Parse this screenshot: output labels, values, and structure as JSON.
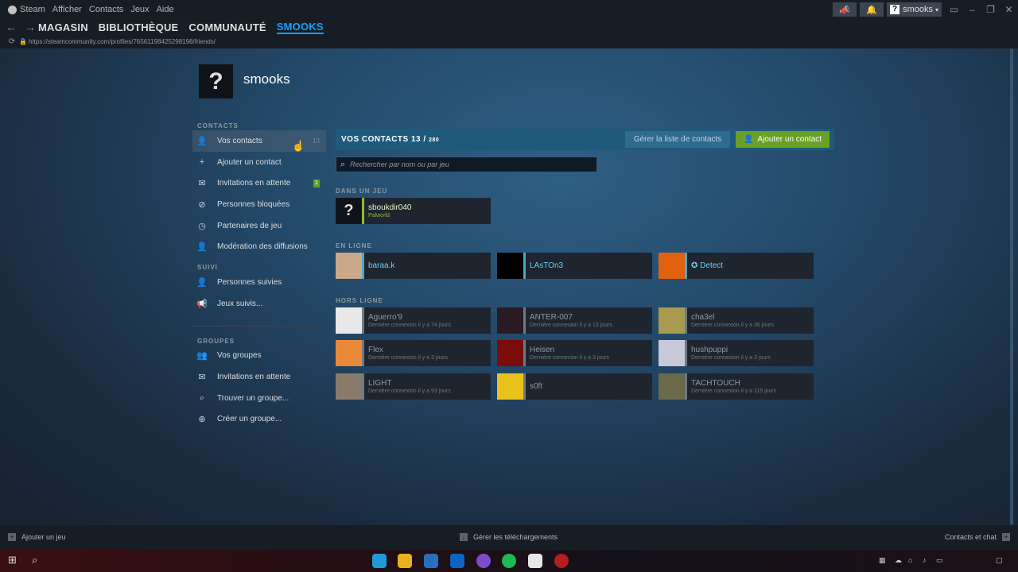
{
  "window": {
    "app_name": "Steam",
    "menu": [
      "Afficher",
      "Contacts",
      "Jeux",
      "Aide"
    ],
    "user_button": "smooks",
    "help_glyph": "?"
  },
  "nav": {
    "tabs": [
      "MAGASIN",
      "BIBLIOTHÈQUE",
      "COMMUNAUTÉ",
      "SMOOKS"
    ],
    "active_tab": "SMOOKS",
    "url": "https://steamcommunity.com/profiles/76561198425298198/friends/"
  },
  "profile": {
    "name": "smooks",
    "avatar_glyph": "?"
  },
  "sidebar": {
    "contacts_title": "CONTACTS",
    "contacts_items": [
      {
        "label": "Vos contacts",
        "icon": "person-icon",
        "count": "13"
      },
      {
        "label": "Ajouter un contact",
        "icon": "add-person-icon"
      },
      {
        "label": "Invitations en attente",
        "icon": "envelope-icon",
        "badge": "1"
      },
      {
        "label": "Personnes bloquées",
        "icon": "blocked-icon"
      },
      {
        "label": "Partenaires de jeu",
        "icon": "clock-icon"
      },
      {
        "label": "Modération des diffusions",
        "icon": "moderation-icon"
      }
    ],
    "follow_title": "SUIVI",
    "follow_items": [
      {
        "label": "Personnes suivies",
        "icon": "followed-people-icon"
      },
      {
        "label": "Jeux suivis...",
        "icon": "megaphone-icon"
      }
    ],
    "groups_title": "GROUPES",
    "groups_items": [
      {
        "label": "Vos groupes",
        "icon": "groups-icon"
      },
      {
        "label": "Invitations en attente",
        "icon": "envelope-icon"
      },
      {
        "label": "Trouver un groupe...",
        "icon": "search-icon"
      },
      {
        "label": "Créer un groupe...",
        "icon": "plus-circle-icon"
      }
    ]
  },
  "contacts": {
    "title": "VOS CONTACTS",
    "count": "13",
    "separator": "/",
    "max": "280",
    "manage_label": "Gérer la liste de contacts",
    "add_label": "Ajouter un contact",
    "search_placeholder": "Rechercher par nom ou par jeu",
    "ingame_title": "DANS UN JEU",
    "online_title": "EN LIGNE",
    "offline_title": "HORS LIGNE",
    "ingame": [
      {
        "name": "sboukdir040",
        "status": "Palworld",
        "avatar": "#0f1318",
        "glyph": "?"
      }
    ],
    "online": [
      {
        "name": "baraa.k",
        "status": "",
        "avatar": "#c9a98a"
      },
      {
        "name": "LAsTOn3",
        "status": "",
        "avatar": "#000000"
      },
      {
        "name": "✪ Detect",
        "status": "",
        "avatar": "#e0620f"
      }
    ],
    "offline": [
      {
        "name": "Aguerro'9",
        "status": "Dernière connexion il y a 74 jours",
        "avatar": "#e8e8e8"
      },
      {
        "name": "ANTER-007",
        "status": "Dernière connexion il y a 13 jours",
        "avatar": "#2a1a22"
      },
      {
        "name": "cha3el",
        "status": "Dernière connexion il y a 36 jours",
        "avatar": "#a89a4e"
      },
      {
        "name": "Flex",
        "status": "Dernière connexion il y a 3 jours",
        "avatar": "#e88a3a"
      },
      {
        "name": "Heisen",
        "status": "Dernière connexion il y a 3 jours",
        "avatar": "#7a0c0c"
      },
      {
        "name": "hushpuppi",
        "status": "Dernière connexion il y a 3 jours",
        "avatar": "#c8c8d8"
      },
      {
        "name": "LIGHT",
        "status": "Dernière connexion il y a 93 jours",
        "avatar": "#8a7a6a"
      },
      {
        "name": "s0ft",
        "status": "",
        "avatar": "#e8c21a"
      },
      {
        "name": "TACHTOUCH",
        "status": "Dernière connexion il y a 115 jours",
        "avatar": "#6a6a4a"
      }
    ]
  },
  "footer": {
    "add_game": "Ajouter un jeu",
    "downloads": "Gérer les téléchargements",
    "chat": "Contacts et chat"
  }
}
